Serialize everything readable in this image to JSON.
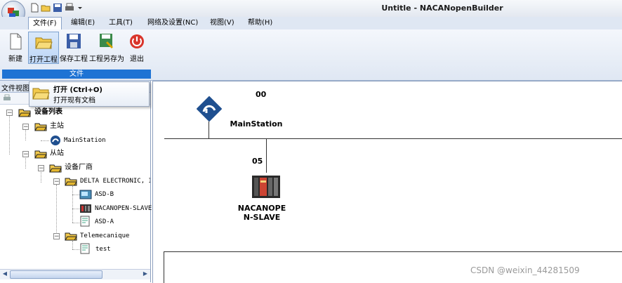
{
  "window": {
    "title": "Untitle - NACANopenBuilder"
  },
  "quick_access": [
    "new-doc-icon",
    "open-folder-icon",
    "save-icon",
    "print-icon",
    "dropdown-arrow-icon"
  ],
  "menu": {
    "tabs": [
      {
        "label": "文件(F)",
        "active": true
      },
      {
        "label": "编辑(E)"
      },
      {
        "label": "工具(T)"
      },
      {
        "label": "网络及设置(NC)"
      },
      {
        "label": "视图(V)"
      },
      {
        "label": "帮助(H)"
      }
    ]
  },
  "ribbon": {
    "buttons": [
      {
        "label": "新建",
        "icon": "new-file-icon"
      },
      {
        "label": "打开工程",
        "icon": "open-folder-icon"
      },
      {
        "label": "保存工程",
        "icon": "save-icon"
      },
      {
        "label": "工程另存为",
        "icon": "save-as-icon"
      },
      {
        "label": "退出",
        "icon": "power-icon"
      }
    ],
    "group_label": "文件"
  },
  "tooltip": {
    "title": "打开 (Ctrl+O)",
    "desc": "打开现有文档"
  },
  "panel": {
    "header": "文件视图"
  },
  "tree": {
    "root": "设备列表",
    "master": "主站",
    "main_station": "MainStation",
    "slaves": "从站",
    "vendors": "设备厂商",
    "vendor1": "DELTA ELECTRONIC, INC.",
    "dev_asdb": "ASD-B",
    "dev_nacanopen": "NACANOPEN-SLAVE",
    "dev_asda": "ASD-A",
    "vendor2": "Telemecanique",
    "dev_test": "test"
  },
  "canvas": {
    "master": {
      "number": "00",
      "label": "MainStation"
    },
    "slave": {
      "number": "05",
      "label_line1": "NACANOPE",
      "label_line2": "N-SLAVE"
    }
  },
  "watermark": "CSDN @weixin_44281509",
  "colors": {
    "ribbon_group_label": "#1e73d4",
    "menu_bar": "#dfe7f3"
  }
}
